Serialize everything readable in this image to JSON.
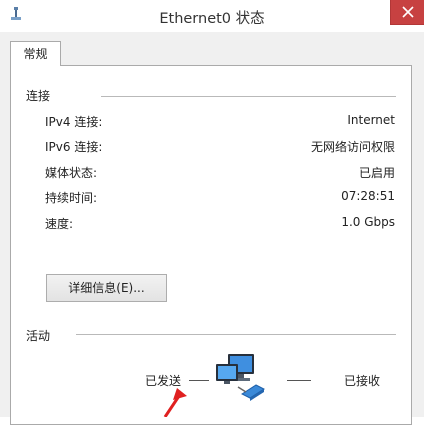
{
  "window": {
    "title": "Ethernet0 状态"
  },
  "tabs": [
    {
      "label": "常规"
    }
  ],
  "connection": {
    "heading": "连接",
    "rows": [
      {
        "label": "IPv4 连接:",
        "value": "Internet"
      },
      {
        "label": "IPv6 连接:",
        "value": "无网络访问权限"
      },
      {
        "label": "媒体状态:",
        "value": "已启用"
      },
      {
        "label": "持续时间:",
        "value": "07:28:51"
      },
      {
        "label": "速度:",
        "value": "1.0 Gbps"
      }
    ],
    "details_button": "详细信息(E)..."
  },
  "activity": {
    "heading": "活动",
    "sent_label": "已发送",
    "received_label": "已接收"
  },
  "icons": {
    "app": "network-icon",
    "close": "close-icon",
    "activity": "network-computers-icon",
    "annotation": "red-arrow-icon"
  },
  "colors": {
    "close_button": "#c74141",
    "annotation_arrow": "#e02020"
  }
}
